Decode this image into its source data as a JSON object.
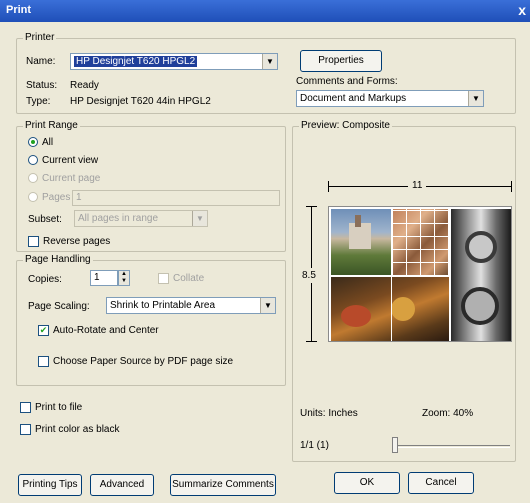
{
  "window": {
    "title": "Print",
    "close_glyph": "x"
  },
  "printer": {
    "legend": "Printer",
    "name_label": "Name:",
    "name_value": "HP Designjet T620       HPGL2",
    "status_label": "Status:",
    "status_value": "Ready",
    "type_label": "Type:",
    "type_value": "HP Designjet T620 44in HPGL2",
    "properties_button": "Properties",
    "comments_label": "Comments and Forms:",
    "comments_value": "Document and Markups"
  },
  "print_range": {
    "legend": "Print Range",
    "all": "All",
    "current_view": "Current view",
    "current_page": "Current page",
    "pages": "Pages",
    "pages_value": "1",
    "subset_label": "Subset:",
    "subset_value": "All pages in range",
    "reverse_pages": "Reverse pages"
  },
  "page_handling": {
    "legend": "Page Handling",
    "copies_label": "Copies:",
    "copies_value": "1",
    "collate": "Collate",
    "scaling_label": "Page Scaling:",
    "scaling_value": "Shrink to Printable Area",
    "auto_rotate": "Auto-Rotate and Center",
    "choose_paper": "Choose Paper Source by PDF page size"
  },
  "options": {
    "print_to_file": "Print to file",
    "print_color_black": "Print color as black"
  },
  "preview": {
    "legend": "Preview: Composite",
    "width_label": "11",
    "height_label": "8.5",
    "units": "Units: Inches",
    "zoom": "Zoom:  40%",
    "page_indicator": "1/1 (1)"
  },
  "buttons": {
    "printing_tips": "Printing Tips",
    "advanced": "Advanced",
    "summarize": "Summarize Comments",
    "ok": "OK",
    "cancel": "Cancel"
  },
  "colors": {
    "dialog_bg": "#ece9d8",
    "titlebar": "#1f4fb8",
    "selection": "#1f3f9a",
    "check_green": "#21a121"
  }
}
